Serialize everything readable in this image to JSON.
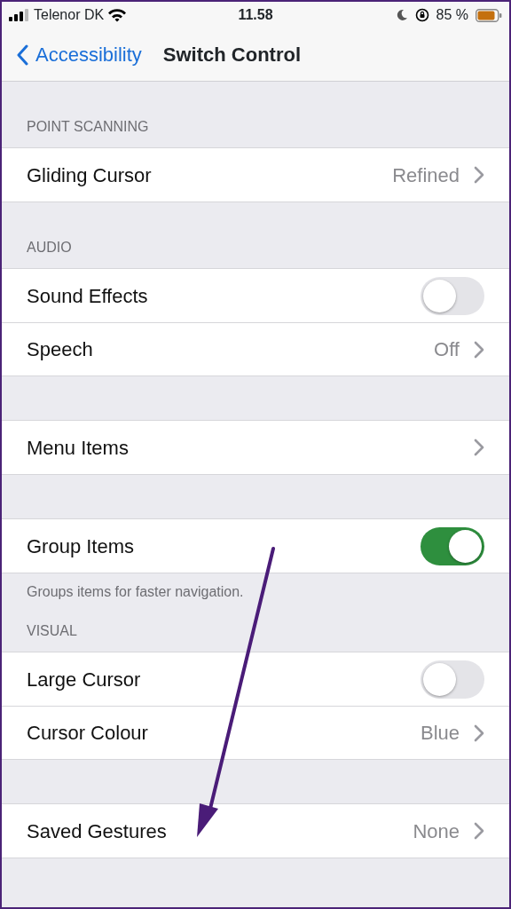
{
  "status_bar": {
    "carrier": "Telenor DK",
    "time": "11.58",
    "battery": "85 %"
  },
  "nav": {
    "back": "Accessibility",
    "title": "Switch Control"
  },
  "sections": [
    {
      "header": "POINT SCANNING",
      "rows": [
        {
          "kind": "link",
          "label": "Gliding Cursor",
          "value": "Refined"
        }
      ]
    },
    {
      "header": "AUDIO",
      "rows": [
        {
          "kind": "toggle",
          "label": "Sound Effects",
          "on": false
        },
        {
          "kind": "link",
          "label": "Speech",
          "value": "Off"
        }
      ]
    },
    {
      "rows": [
        {
          "kind": "link",
          "label": "Menu Items"
        }
      ]
    },
    {
      "footer": "Groups items for faster navigation.",
      "rows": [
        {
          "kind": "toggle",
          "label": "Group Items",
          "on": true
        }
      ]
    },
    {
      "header": "VISUAL",
      "rows": [
        {
          "kind": "toggle",
          "label": "Large Cursor",
          "on": false
        },
        {
          "kind": "link",
          "label": "Cursor Colour",
          "value": "Blue"
        }
      ]
    },
    {
      "rows": [
        {
          "kind": "link",
          "label": "Saved Gestures",
          "value": "None"
        }
      ]
    }
  ]
}
